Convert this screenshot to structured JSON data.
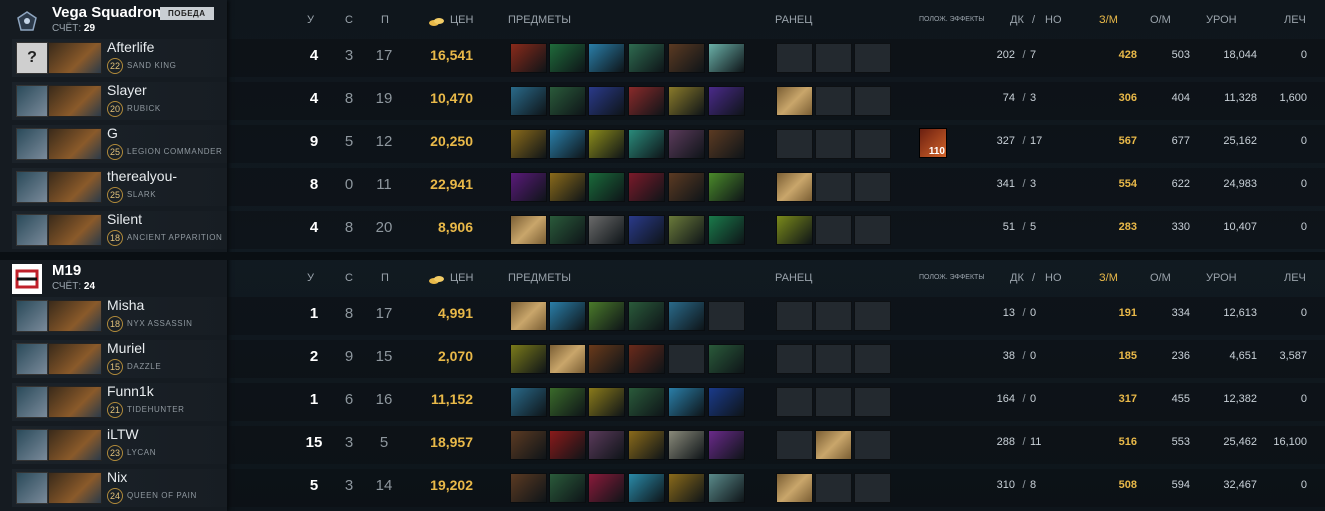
{
  "headers": {
    "k": "У",
    "d": "С",
    "a": "П",
    "cost": "ЦЕН",
    "items": "ПРЕДМЕТЫ",
    "backpack": "РАНЕЦ",
    "buffs": "ПОЛОЖ. ЭФФЕКТЫ",
    "lh": "ДК",
    "slash": "/",
    "dn": "НО",
    "gpm": "З/М",
    "xpm": "О/М",
    "dmg": "УРОН",
    "heal": "ЛЕЧ"
  },
  "teams": [
    {
      "name": "Vega Squadron",
      "score_label": "СЧЁТ:",
      "score": "29",
      "badge": "ПОБЕДА",
      "players": [
        {
          "name": "Afterlife",
          "level": "22",
          "hero": "SAND KING",
          "k": "4",
          "d": "3",
          "a": "17",
          "gold": "16,541",
          "lh": "202",
          "dn": "7",
          "gpm": "428",
          "xpm": "503",
          "dmg": "18,044",
          "heal": "0",
          "items": [
            "#8a2a1a",
            "#1f6a3a",
            "#2a7ea8",
            "#2e6a4f",
            "#5b3a22",
            "#6ab0a8"
          ],
          "backpack": [
            "",
            "",
            ""
          ],
          "buff": ""
        },
        {
          "name": "Slayer",
          "level": "20",
          "hero": "RUBICK",
          "k": "4",
          "d": "8",
          "a": "19",
          "gold": "10,470",
          "lh": "74",
          "dn": "3",
          "gpm": "306",
          "xpm": "404",
          "dmg": "11,328",
          "heal": "1,600",
          "items": [
            "#2a6a8a",
            "#2a5a3a",
            "#2a3a8a",
            "#8a2a2a",
            "#8a7a2a",
            "#4a2a8a"
          ],
          "backpack": [
            "scroll",
            "",
            ""
          ],
          "buff": ""
        },
        {
          "name": "G",
          "level": "25",
          "hero": "LEGION COMMANDER",
          "k": "9",
          "d": "5",
          "a": "12",
          "gold": "20,250",
          "lh": "327",
          "dn": "17",
          "gpm": "567",
          "xpm": "677",
          "dmg": "25,162",
          "heal": "0",
          "items": [
            "#8a6a1a",
            "#2a7ea8",
            "#8a8a1a",
            "#2a8a7a",
            "#5a3a5a",
            "#5b3a22"
          ],
          "backpack": [
            "",
            "",
            ""
          ],
          "buff": "110"
        },
        {
          "name": "therealyou-",
          "level": "25",
          "hero": "SLARK",
          "k": "8",
          "d": "0",
          "a": "11",
          "gold": "22,941",
          "lh": "341",
          "dn": "3",
          "gpm": "554",
          "xpm": "622",
          "dmg": "24,983",
          "heal": "0",
          "items": [
            "#5a1a7a",
            "#8a6a1a",
            "#1a6a3a",
            "#7a1a2a",
            "#5b3a22",
            "#4a8a2a"
          ],
          "backpack": [
            "scroll",
            "",
            ""
          ],
          "buff": ""
        },
        {
          "name": "Silent",
          "level": "18",
          "hero": "ANCIENT APPARITION",
          "k": "4",
          "d": "8",
          "a": "20",
          "gold": "8,906",
          "lh": "51",
          "dn": "5",
          "gpm": "283",
          "xpm": "330",
          "dmg": "10,407",
          "heal": "0",
          "items": [
            "scroll",
            "#2a5a3a",
            "#6a6a6a",
            "#2a3a8a",
            "#6a7a3a",
            "#1a7a4a"
          ],
          "backpack": [
            "#7a8a1a",
            "",
            ""
          ],
          "buff": ""
        }
      ]
    },
    {
      "name": "M19",
      "score_label": "СЧЁТ:",
      "score": "24",
      "badge": "",
      "players": [
        {
          "name": "Misha",
          "level": "18",
          "hero": "NYX ASSASSIN",
          "k": "1",
          "d": "8",
          "a": "17",
          "gold": "4,991",
          "lh": "13",
          "dn": "0",
          "gpm": "191",
          "xpm": "334",
          "dmg": "12,613",
          "heal": "0",
          "items": [
            "scroll",
            "#2a7ea8",
            "#4a7a2a",
            "#2a5a3a",
            "#2a6a8a",
            ""
          ],
          "backpack": [
            "",
            "",
            ""
          ],
          "buff": ""
        },
        {
          "name": "Muriel",
          "level": "15",
          "hero": "DAZZLE",
          "k": "2",
          "d": "9",
          "a": "15",
          "gold": "2,070",
          "lh": "38",
          "dn": "0",
          "gpm": "185",
          "xpm": "236",
          "dmg": "4,651",
          "heal": "3,587",
          "items": [
            "#7a7a1a",
            "scroll",
            "#6a3a1a",
            "#6a2a1a",
            "",
            "#2a5a3a"
          ],
          "backpack": [
            "",
            "",
            ""
          ],
          "buff": ""
        },
        {
          "name": "Funn1k",
          "level": "21",
          "hero": "TIDEHUNTER",
          "k": "1",
          "d": "6",
          "a": "16",
          "gold": "11,152",
          "lh": "164",
          "dn": "0",
          "gpm": "317",
          "xpm": "455",
          "dmg": "12,382",
          "heal": "0",
          "items": [
            "#2a6a8a",
            "#3a6a2a",
            "#8a7a1a",
            "#2a5a3a",
            "#2a7ea8",
            "#1a3a8a"
          ],
          "backpack": [
            "",
            "",
            ""
          ],
          "buff": ""
        },
        {
          "name": "iLTW",
          "level": "23",
          "hero": "LYCAN",
          "k": "15",
          "d": "3",
          "a": "5",
          "gold": "18,957",
          "lh": "288",
          "dn": "11",
          "gpm": "516",
          "xpm": "553",
          "dmg": "25,462",
          "heal": "16,100",
          "items": [
            "#5b3a22",
            "#8a1a1a",
            "#5a3a5a",
            "#8a6a1a",
            "#8a8a7a",
            "#6a2a8a"
          ],
          "backpack": [
            "",
            "scroll",
            ""
          ],
          "buff": ""
        },
        {
          "name": "Nix",
          "level": "24",
          "hero": "QUEEN OF PAIN",
          "k": "5",
          "d": "3",
          "a": "14",
          "gold": "19,202",
          "lh": "310",
          "dn": "8",
          "gpm": "508",
          "xpm": "594",
          "dmg": "32,467",
          "heal": "0",
          "items": [
            "#5b3a22",
            "#2a5a3a",
            "#8a1a3a",
            "#2a8aa8",
            "#8a6a1a",
            "#5a8a8a"
          ],
          "backpack": [
            "scroll",
            "",
            ""
          ],
          "buff": ""
        }
      ]
    }
  ],
  "colors": {
    "gold": "#e9b949",
    "panel": "#151b21",
    "accent_win": "#c9ced3"
  }
}
